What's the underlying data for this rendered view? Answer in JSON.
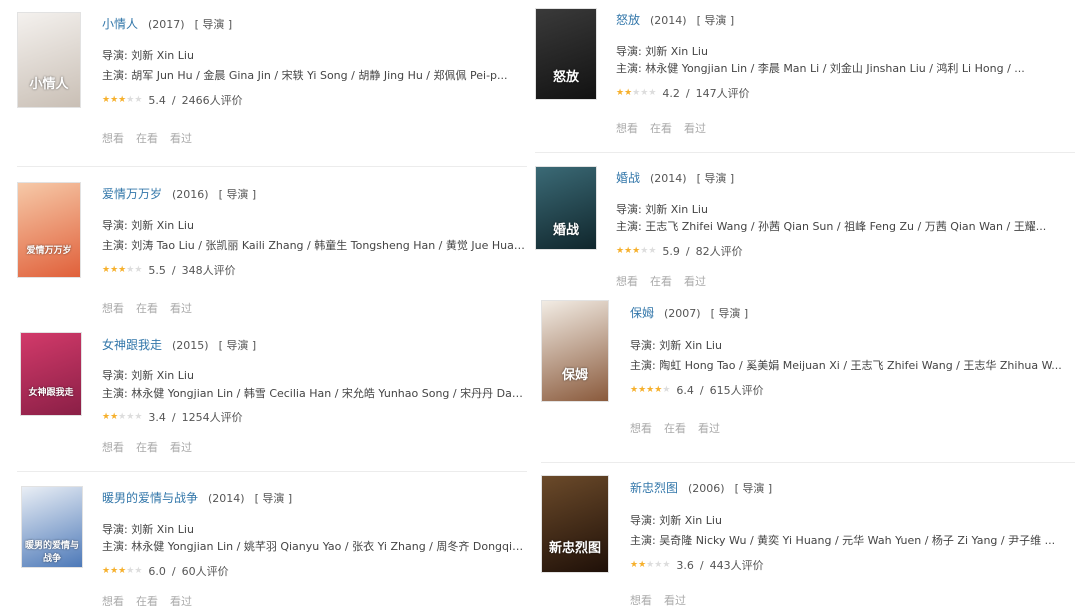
{
  "director_label": "导演: 刘新 Xin Liu",
  "actions": [
    "想看",
    "在看",
    "看过"
  ],
  "entries": [
    {
      "title": "小情人",
      "year": "(2017)",
      "role": "[ 导演 ]",
      "cast": "主演: 胡军 Jun Hu / 金晨 Gina Jin / 宋轶 Yi Song / 胡静 Jing Hu / 郑佩佩 Pei-p...",
      "score": "5.4",
      "votes": "2466人评价",
      "stars": 3,
      "poster_caption": "小情人",
      "poster_colors": [
        "#f4f1ee",
        "#c9bfb5"
      ]
    },
    {
      "title": "爱情万万岁",
      "year": "(2016)",
      "role": "[ 导演 ]",
      "cast": "主演: 刘涛 Tao Liu / 张凯丽 Kaili Zhang / 韩童生 Tongsheng Han / 黄觉 Jue Huan...",
      "score": "5.5",
      "votes": "348人评价",
      "stars": 3,
      "poster_caption": "爱情万万岁",
      "poster_colors": [
        "#f6c9a8",
        "#e0603a"
      ]
    },
    {
      "title": "女神跟我走",
      "year": "(2015)",
      "role": "[ 导演 ]",
      "cast": "主演: 林永健 Yongjian Lin / 韩雪 Cecilia Han / 宋允皓 Yunhao Song / 宋丹丹 Dan...",
      "score": "3.4",
      "votes": "1254人评价",
      "stars": 2,
      "poster_caption": "女神跟我走",
      "poster_colors": [
        "#d23a6a",
        "#8a1f46"
      ]
    },
    {
      "title": "暖男的爱情与战争",
      "year": "(2014)",
      "role": "[ 导演 ]",
      "cast": "主演: 林永健 Yongjian Lin / 姚芊羽 Qianyu Yao / 张衣 Yi Zhang / 周冬齐 Dongqi ...",
      "score": "6.0",
      "votes": "60人评价",
      "stars": 3,
      "poster_caption": "暖男的爱情与战争",
      "poster_colors": [
        "#e9eef5",
        "#4d79b8"
      ]
    },
    {
      "title": "怒放",
      "year": "(2014)",
      "role": "[ 导演 ]",
      "cast": "主演: 林永健 Yongjian Lin / 李晨 Man Li / 刘金山 Jinshan Liu / 鸿利 Li Hong / ...",
      "score": "4.2",
      "votes": "147人评价",
      "stars": 2,
      "poster_caption": "怒放",
      "poster_colors": [
        "#3a3a3a",
        "#121212"
      ]
    },
    {
      "title": "婚战",
      "year": "(2014)",
      "role": "[ 导演 ]",
      "cast": "主演: 王志飞 Zhifei Wang / 孙茜 Qian Sun / 祖峰 Feng Zu / 万茜 Qian Wan / 王耀...",
      "score": "5.9",
      "votes": "82人评价",
      "stars": 3,
      "poster_caption": "婚战",
      "poster_colors": [
        "#3b6a76",
        "#10262c"
      ]
    },
    {
      "title": "保姆",
      "year": "(2007)",
      "role": "[ 导演 ]",
      "cast": "主演: 陶虹 Hong Tao / 奚美娟 Meijuan Xi / 王志飞 Zhifei Wang / 王志华 Zhihua W...",
      "score": "6.4",
      "votes": "615人评价",
      "stars": 3.5,
      "poster_caption": "保姆",
      "poster_colors": [
        "#f2ece4",
        "#8a5a3c"
      ]
    },
    {
      "title": "新忠烈图",
      "year": "(2006)",
      "role": "[ 导演 ]",
      "cast": "主演: 吴奇隆 Nicky Wu / 黄奕 Yi Huang / 元华 Wah Yuen / 杨子 Zi Yang / 尹子维 ...",
      "score": "3.6",
      "votes": "443人评价",
      "stars": 2,
      "poster_caption": "新忠烈图",
      "poster_colors": [
        "#6b4a2a",
        "#1f1008"
      ]
    }
  ]
}
